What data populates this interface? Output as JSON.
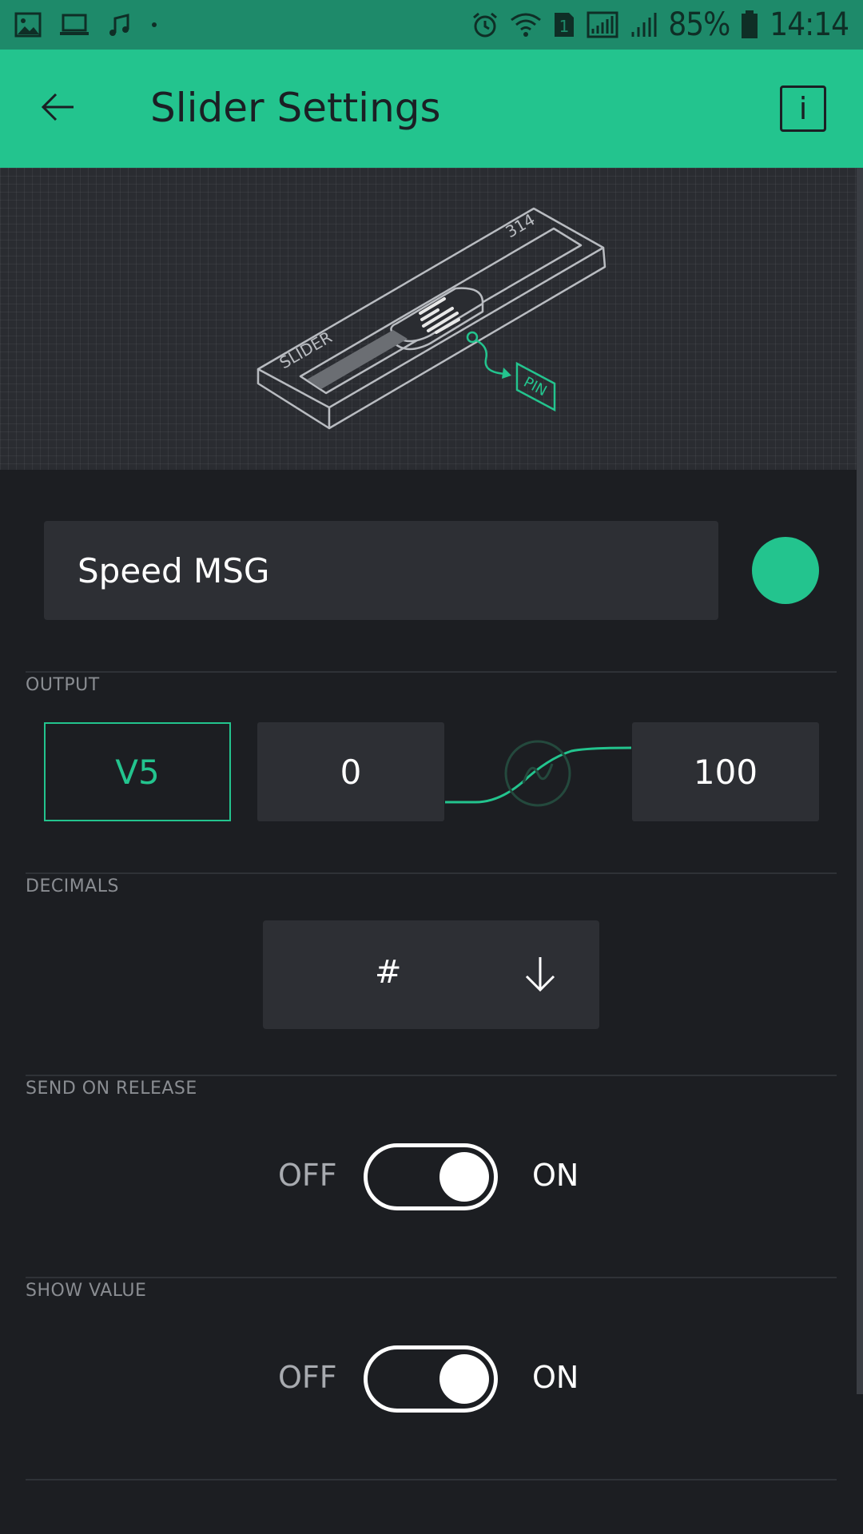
{
  "status_bar": {
    "battery": "85%",
    "time": "14:14",
    "sim_slot": "1",
    "icons": [
      "image-icon",
      "laptop-icon",
      "music-icon",
      "dot-icon",
      "alarm-icon",
      "wifi-icon",
      "sim-icon",
      "signal-icon",
      "signal-icon",
      "battery-icon"
    ]
  },
  "appbar": {
    "title": "Slider Settings",
    "back_icon": "arrow-left-icon",
    "info_label": "i"
  },
  "illustration": {
    "slider_text": "SLIDER",
    "value_text": "314",
    "pin_text": "PIN"
  },
  "name_field": {
    "value": "Speed MSG"
  },
  "colors": {
    "accent": "#23c48e",
    "background": "#1c1e22",
    "field": "#2d2f34"
  },
  "output": {
    "label": "OUTPUT",
    "pin": "V5",
    "min": "0",
    "max": "100"
  },
  "decimals": {
    "label": "DECIMALS",
    "value": "#"
  },
  "send_on_release": {
    "label": "SEND ON RELEASE",
    "off_label": "OFF",
    "on_label": "ON",
    "state": "on"
  },
  "show_value": {
    "label": "SHOW VALUE",
    "off_label": "OFF",
    "on_label": "ON",
    "state": "on"
  }
}
